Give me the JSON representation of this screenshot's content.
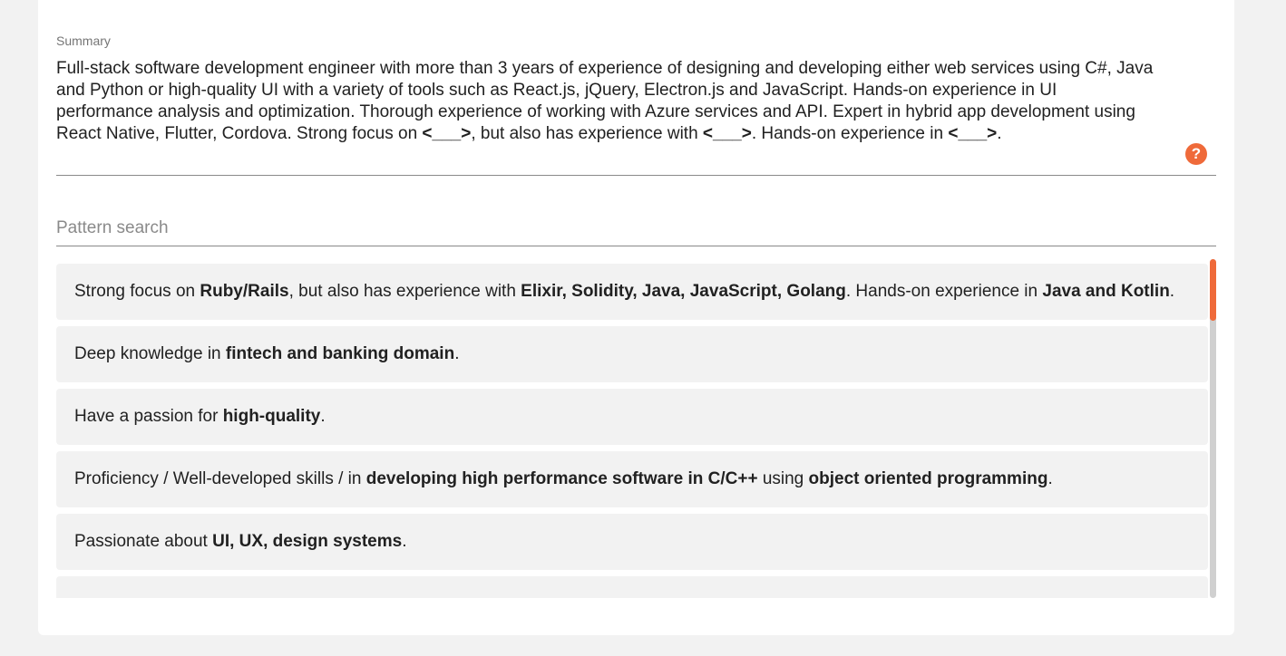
{
  "summary": {
    "label": "Summary",
    "segments": [
      {
        "text": "Full-stack software development engineer with more than 3 years of experience of designing and developing either web services using C#, Java and Python or high-quality UI with a variety of tools such as React.js, jQuery, Electron.js and JavaScript. Hands-on experience in UI performance analysis and optimization. Thorough experience of working with Azure services and API. Expert in hybrid app development using React Native, Flutter, Cordova. Strong focus on ",
        "bold": false
      },
      {
        "text": "<___>",
        "bold": true
      },
      {
        "text": ", but also has experience with ",
        "bold": false
      },
      {
        "text": "<___>",
        "bold": true
      },
      {
        "text": ". Hands-on experience in ",
        "bold": false
      },
      {
        "text": "<___>",
        "bold": true
      },
      {
        "text": ".",
        "bold": false
      }
    ],
    "help_glyph": "?",
    "help_icon": "question-circle-icon"
  },
  "search": {
    "placeholder": "Pattern search",
    "value": ""
  },
  "results": [
    [
      {
        "text": "Strong focus on ",
        "bold": false
      },
      {
        "text": "Ruby/Rails",
        "bold": true
      },
      {
        "text": ", but also has experience with ",
        "bold": false
      },
      {
        "text": "Elixir, Solidity, Java, JavaScript, Golang",
        "bold": true
      },
      {
        "text": ". Hands-on experience in ",
        "bold": false
      },
      {
        "text": "Java and Kotlin",
        "bold": true
      },
      {
        "text": ".",
        "bold": false
      }
    ],
    [
      {
        "text": "Deep knowledge in ",
        "bold": false
      },
      {
        "text": "fintech and banking domain",
        "bold": true
      },
      {
        "text": ".",
        "bold": false
      }
    ],
    [
      {
        "text": "Have a passion for ",
        "bold": false
      },
      {
        "text": "high-quality",
        "bold": true
      },
      {
        "text": ".",
        "bold": false
      }
    ],
    [
      {
        "text": "Proficiency / Well-developed skills / in ",
        "bold": false
      },
      {
        "text": "developing high performance software in C/C++",
        "bold": true
      },
      {
        "text": " using ",
        "bold": false
      },
      {
        "text": "object oriented programming",
        "bold": true
      },
      {
        "text": ".",
        "bold": false
      }
    ],
    [
      {
        "text": "Passionate about ",
        "bold": false
      },
      {
        "text": "UI, UX, design systems",
        "bold": true
      },
      {
        "text": ".",
        "bold": false
      }
    ],
    [
      {
        "text": "",
        "bold": false
      }
    ]
  ],
  "colors": {
    "accent": "#ef6a3a",
    "background": "#f2f2f2",
    "card": "#ffffff",
    "item_background": "#f2f2f2"
  }
}
